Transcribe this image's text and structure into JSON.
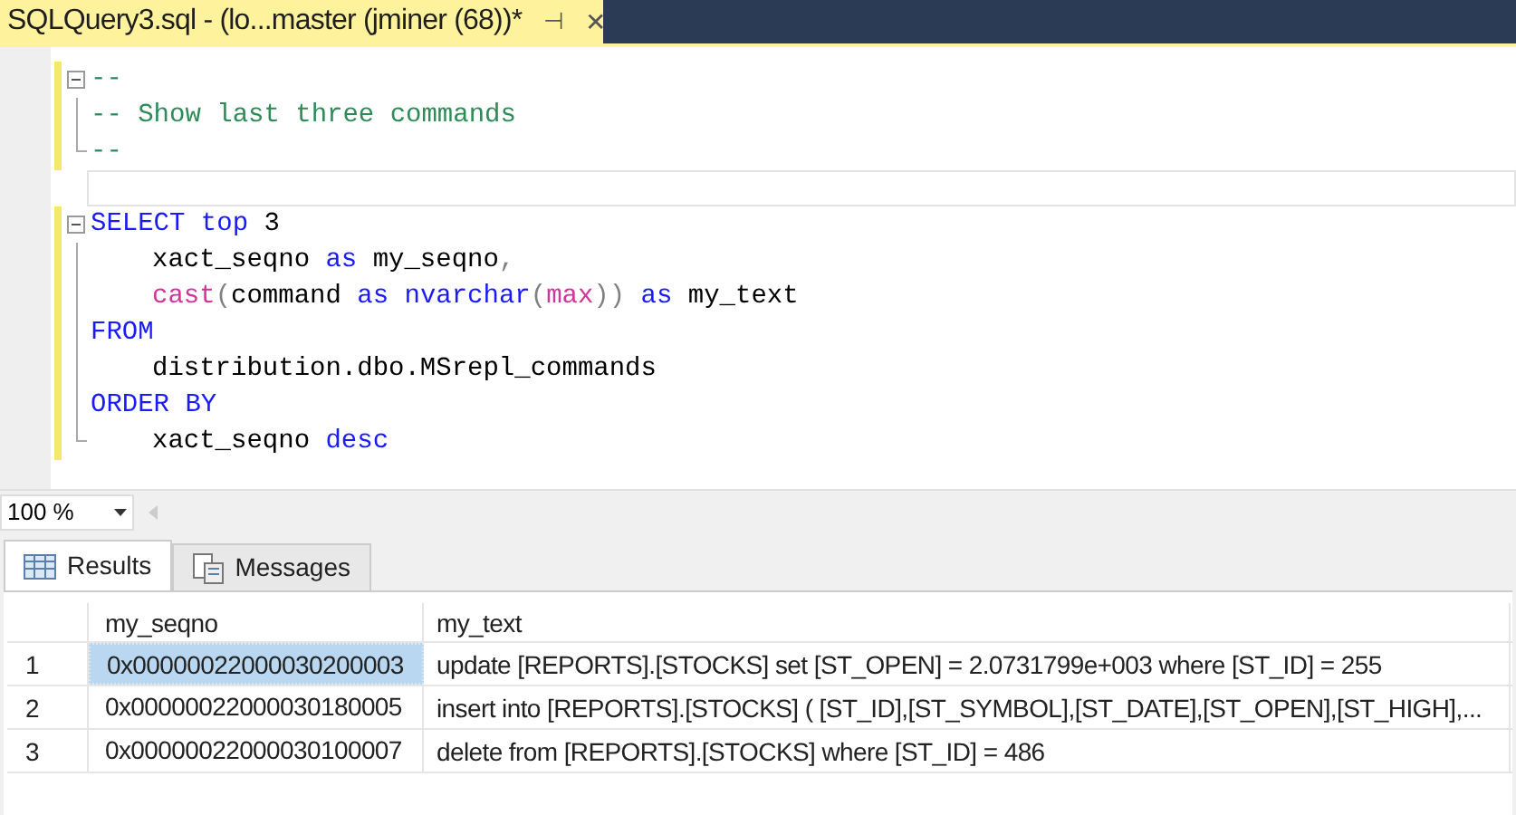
{
  "document_tab": {
    "title": "SQLQuery3.sql - (lo...master (jminer (68))*",
    "pin": "⊣",
    "close": "✕"
  },
  "code_lines": [
    {
      "kind": "start",
      "tokens": [
        {
          "kind": "comment",
          "text": "--"
        }
      ]
    },
    {
      "kind": "body",
      "tokens": [
        {
          "kind": "comment",
          "text": "-- Show last three commands"
        }
      ]
    },
    {
      "kind": "end",
      "tokens": [
        {
          "kind": "comment",
          "text": "--"
        }
      ]
    },
    {
      "kind": "blank",
      "current": true
    },
    {
      "kind": "start",
      "tokens": [
        {
          "kind": "keyword",
          "text": "SELECT"
        },
        {
          "kind": "keyword",
          "text": " top"
        },
        {
          "kind": "plain",
          "text": " 3"
        }
      ]
    },
    {
      "kind": "body",
      "indented": true,
      "tokens": [
        {
          "kind": "plain",
          "text": "xact_seqno "
        },
        {
          "kind": "keyword",
          "text": "as"
        },
        {
          "kind": "plain",
          "text": " my_seqno"
        },
        {
          "kind": "operator",
          "text": ","
        }
      ]
    },
    {
      "kind": "body",
      "indented": true,
      "tokens": [
        {
          "kind": "function",
          "text": "cast"
        },
        {
          "kind": "operator",
          "text": "("
        },
        {
          "kind": "plain",
          "text": "command "
        },
        {
          "kind": "keyword",
          "text": "as nvarchar"
        },
        {
          "kind": "operator",
          "text": "("
        },
        {
          "kind": "function",
          "text": "max"
        },
        {
          "kind": "operator",
          "text": ")) "
        },
        {
          "kind": "keyword",
          "text": "as"
        },
        {
          "kind": "plain",
          "text": " my_text"
        }
      ]
    },
    {
      "kind": "body",
      "tokens": [
        {
          "kind": "keyword",
          "text": "FROM"
        }
      ]
    },
    {
      "kind": "body",
      "indented": true,
      "tokens": [
        {
          "kind": "plain",
          "text": "distribution.dbo.MSrepl_commands"
        }
      ]
    },
    {
      "kind": "body",
      "tokens": [
        {
          "kind": "keyword",
          "text": "ORDER BY"
        }
      ]
    },
    {
      "kind": "end",
      "indented": true,
      "tokens": [
        {
          "kind": "plain",
          "text": "xact_seqno "
        },
        {
          "kind": "keyword",
          "text": "desc"
        }
      ]
    }
  ],
  "zoom": {
    "value": "100 %"
  },
  "result_tabs": [
    {
      "label": "Results",
      "kind": "grid",
      "selected": true
    },
    {
      "label": "Messages",
      "kind": "messages",
      "selected": false
    }
  ],
  "grid": {
    "columns": [
      "my_seqno",
      "my_text"
    ],
    "rows": [
      {
        "number": "1",
        "selected": true,
        "cells": [
          "0x00000022000030200003",
          "update [REPORTS].[STOCKS] set [ST_OPEN] = 2.0731799e+003 where [ST_ID] = 255"
        ]
      },
      {
        "number": "2",
        "selected": false,
        "cells": [
          "0x00000022000030180005",
          "insert into [REPORTS].[STOCKS] ( [ST_ID],[ST_SYMBOL],[ST_DATE],[ST_OPEN],[ST_HIGH],..."
        ]
      },
      {
        "number": "3",
        "selected": false,
        "cells": [
          "0x00000022000030100007",
          "delete from [REPORTS].[STOCKS] where [ST_ID] = 486"
        ]
      }
    ]
  }
}
